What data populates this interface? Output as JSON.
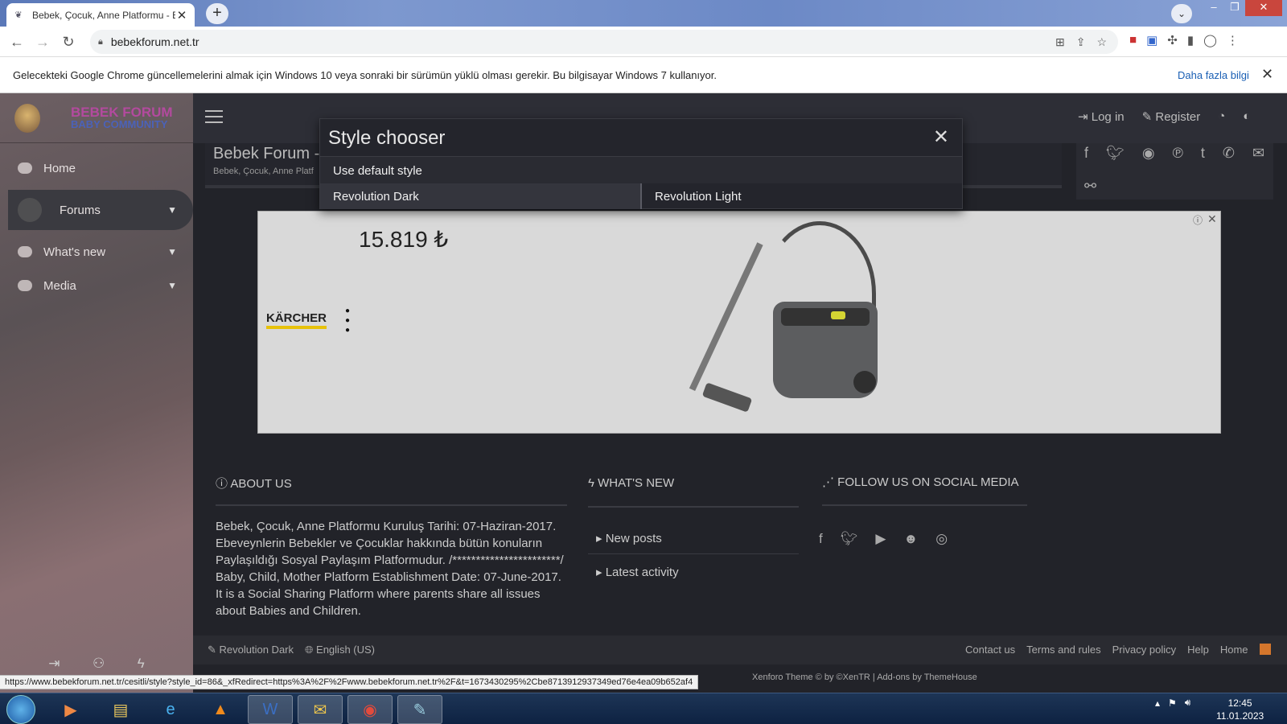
{
  "browser": {
    "tab_title": "Bebek, Çocuk, Anne Platformu - B",
    "new_tab": "+",
    "address": "bebekforum.net.tr",
    "info_message": "Gelecekteki Google Chrome güncellemelerini almak için Windows 10 veya sonraki bir sürümün yüklü olması gerekir. Bu bilgisayar Windows 7 kullanıyor.",
    "info_link": "Daha fazla bilgi",
    "status_url": "https://www.bebekforum.net.tr/cesitli/style?style_id=86&_xfRedirect=https%3A%2F%2Fwww.bebekforum.net.tr%2F&t=1673430295%2Cbe8713912937349ed76e4ea09b652af4"
  },
  "site": {
    "logo_line1": "BEBEK FORUM",
    "logo_line2": "BABY COMMUNITY",
    "nav": [
      {
        "label": "Home"
      },
      {
        "label": "Forums"
      },
      {
        "label": "What's new"
      },
      {
        "label": "Media"
      }
    ],
    "login": "Log in",
    "register": "Register",
    "page_title": "Bebek Forum -",
    "page_subtitle": "Bebek, Çocuk, Anne Platf"
  },
  "ad": {
    "price": "15.819 ₺",
    "brand": "KÄRCHER"
  },
  "modal": {
    "title": "Style chooser",
    "default_option": "Use default style",
    "options": [
      {
        "label": "Revolution Dark"
      },
      {
        "label": "Revolution Light"
      }
    ]
  },
  "footer": {
    "about_heading": "ABOUT US",
    "about_text": "Bebek, Çocuk, Anne Platformu Kuruluş Tarihi: 07-Haziran-2017. Ebeveynlerin Bebekler ve Çocuklar hakkında bütün konuların Paylaşıldığı Sosyal Paylaşım Platformudur. /***********************/ Baby, Child, Mother Platform Establishment Date: 07-June-2017. It is a Social Sharing Platform where parents share all issues about Babies and Children.",
    "whats_new_heading": "WHAT'S NEW",
    "whats_new_links": [
      {
        "label": "New posts"
      },
      {
        "label": "Latest activity"
      }
    ],
    "social_heading": "FOLLOW US ON SOCIAL MEDIA",
    "style_link": "Revolution Dark",
    "language_link": "English (US)",
    "links": [
      {
        "label": "Contact us"
      },
      {
        "label": "Terms and rules"
      },
      {
        "label": "Privacy policy"
      },
      {
        "label": "Help"
      },
      {
        "label": "Home"
      }
    ],
    "copyright": "Xenforo Theme © by ©XenTR | Add-ons by ThemeHouse"
  },
  "taskbar": {
    "time": "12:45",
    "date": "11.01.2023"
  }
}
